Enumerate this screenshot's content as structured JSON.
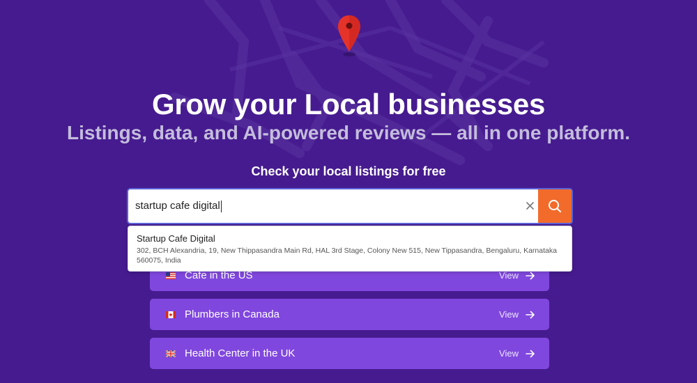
{
  "hero": {
    "headline": "Grow your Local businesses",
    "subheadline": "Listings, data, and AI-powered reviews — all in one platform.",
    "check_label": "Check your local listings for free"
  },
  "search": {
    "value": "startup cafe digital",
    "clear_icon": "close-icon",
    "button_icon": "search-icon"
  },
  "suggestion": {
    "name": "Startup Cafe Digital",
    "address": "302, BCH Alexandria, 19, New Thippasandra Main Rd, HAL 3rd Stage, Colony New 515, New Tippasandra, Bengaluru, Karnataka 560075, India"
  },
  "listings": [
    {
      "flag": "us-flag-icon",
      "label": "Cafe in the US",
      "view": "View"
    },
    {
      "flag": "canada-flag-icon",
      "label": "Plumbers in Canada",
      "view": "View"
    },
    {
      "flag": "uk-flag-icon",
      "label": "Health Center in the UK",
      "view": "View"
    }
  ],
  "colors": {
    "background": "#461b8f",
    "accent_button": "#f26b2b",
    "card": "#8047de",
    "search_border": "#5b63d8"
  }
}
